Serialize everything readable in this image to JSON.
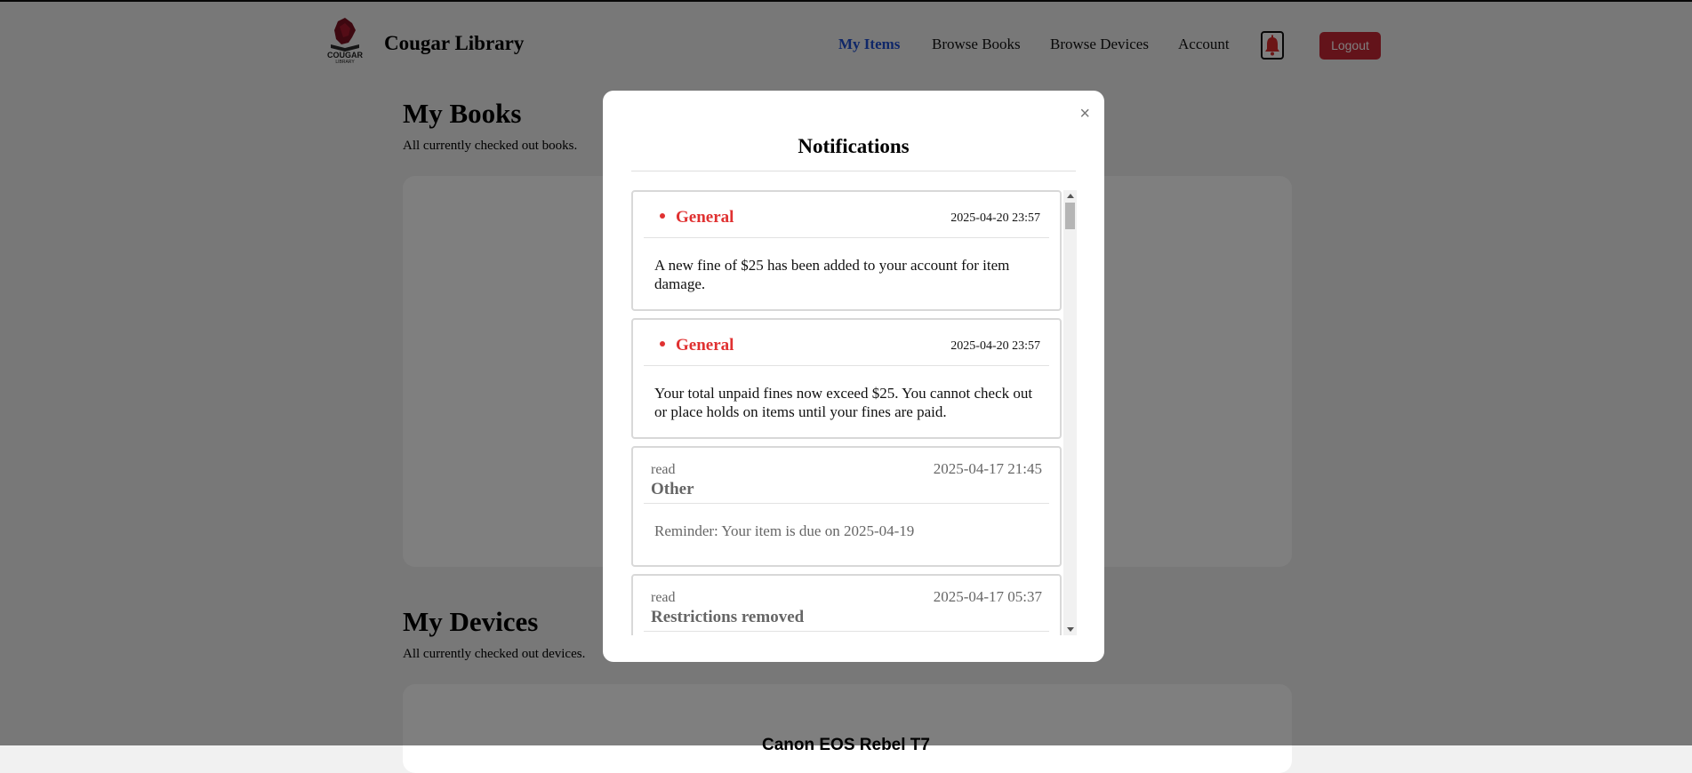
{
  "app": {
    "brand": "Cougar Library",
    "logo_text": "COUGAR LIBRARY"
  },
  "nav": {
    "items": [
      "My Items",
      "Browse Books",
      "Browse Devices",
      "Account"
    ],
    "active": "My Items",
    "logout": "Logout",
    "notification_icon": "bell-icon"
  },
  "books_section": {
    "title": "My Books",
    "subtitle": "All currently checked out books."
  },
  "devices_section": {
    "title": "My Devices",
    "subtitle": "All currently checked out devices.",
    "first_device": "Canon EOS Rebel T7"
  },
  "modal": {
    "title": "Notifications",
    "close": "×",
    "notifications": [
      {
        "status": "unread",
        "type": "General",
        "time": "2025-04-20 23:57",
        "message": "A new fine of $25 has been added to your account for item damage."
      },
      {
        "status": "unread",
        "type": "General",
        "time": "2025-04-20 23:57",
        "message": "Your total unpaid fines now exceed $25. You cannot check out or place holds on items until your fines are paid."
      },
      {
        "status": "read",
        "type": "Other",
        "time": "2025-04-17 21:45",
        "message": "Reminder: Your item is due on 2025-04-19"
      },
      {
        "status": "read",
        "type": "Restrictions removed",
        "time": "2025-04-17 05:37",
        "message": ""
      }
    ]
  },
  "colors": {
    "accent": "#1f4fd1",
    "brand_red": "#c62634",
    "unread": "#e03131"
  }
}
